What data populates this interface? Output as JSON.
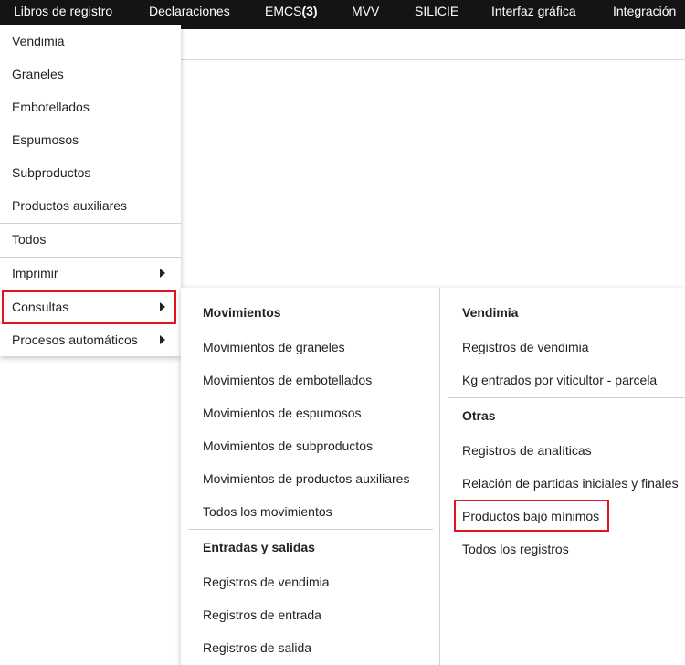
{
  "topnav": {
    "items": [
      {
        "label": "Libros de registro"
      },
      {
        "label": "Declaraciones"
      },
      {
        "label": "EMCS",
        "badge": "(3)"
      },
      {
        "label": "MVV"
      },
      {
        "label": "SILICIE"
      },
      {
        "label": "Interfaz gráfica"
      },
      {
        "label": "Integración"
      }
    ]
  },
  "main_menu": {
    "items": [
      "Vendimia",
      "Graneles",
      "Embotellados",
      "Espumosos",
      "Subproductos",
      "Productos auxiliares",
      "Todos",
      "Imprimir",
      "Consultas",
      "Procesos automáticos"
    ]
  },
  "submenu": {
    "col1": {
      "group1": {
        "heading": "Movimientos",
        "items": [
          "Movimientos de graneles",
          "Movimientos de embotellados",
          "Movimientos de espumosos",
          "Movimientos de subproductos",
          "Movimientos de productos auxiliares",
          "Todos los movimientos"
        ]
      },
      "group2": {
        "heading": "Entradas y salidas",
        "items": [
          "Registros de vendimia",
          "Registros de entrada",
          "Registros de salida"
        ]
      }
    },
    "col2": {
      "group1": {
        "heading": "Vendimia",
        "items": [
          "Registros de vendimia",
          "Kg entrados por viticultor - parcela"
        ]
      },
      "group2": {
        "heading": "Otras",
        "items": [
          "Registros de analíticas",
          "Relación de partidas iniciales y finales",
          "Productos bajo mínimos",
          "Todos los registros"
        ]
      }
    }
  },
  "colors": {
    "nav_bg": "#141414",
    "highlight": "#e0141e"
  }
}
